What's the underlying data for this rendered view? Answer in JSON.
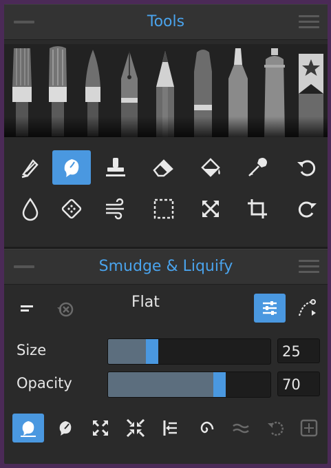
{
  "tools_panel": {
    "title": "Tools"
  },
  "brushes": [
    "flat-brush",
    "round-brush",
    "fan-brush",
    "ink-pen",
    "pencil",
    "marker",
    "felt-pen",
    "spray-can",
    "favorites-bookmark"
  ],
  "tool_rows": [
    [
      "paint-brush-icon",
      "smudge-icon",
      "stamp-icon",
      "eraser-icon",
      "fill-bucket-icon",
      "eyedropper-icon",
      "undo-icon"
    ],
    [
      "water-drop-icon",
      "pattern-icon",
      "wind-icon",
      "selection-icon",
      "transform-icon",
      "crop-icon",
      "redo-icon"
    ]
  ],
  "active_tool": "smudge-icon",
  "smudge_panel": {
    "title": "Smudge & Liquify",
    "mode_value": "Flat",
    "size_label": "Size",
    "size_value": "25",
    "size_level": 0.25,
    "opacity_label": "Opacity",
    "opacity_value": "70",
    "opacity_level": 0.7
  },
  "liquify_tools": [
    "smudge-mode-icon",
    "blend-mode-icon",
    "expand-icon",
    "shrink-icon",
    "align-icon",
    "swirl-icon",
    "wave-icon",
    "restore-icon",
    "reset-icon"
  ],
  "colors": {
    "accent": "#4a98e0",
    "title": "#4aa3ec"
  }
}
